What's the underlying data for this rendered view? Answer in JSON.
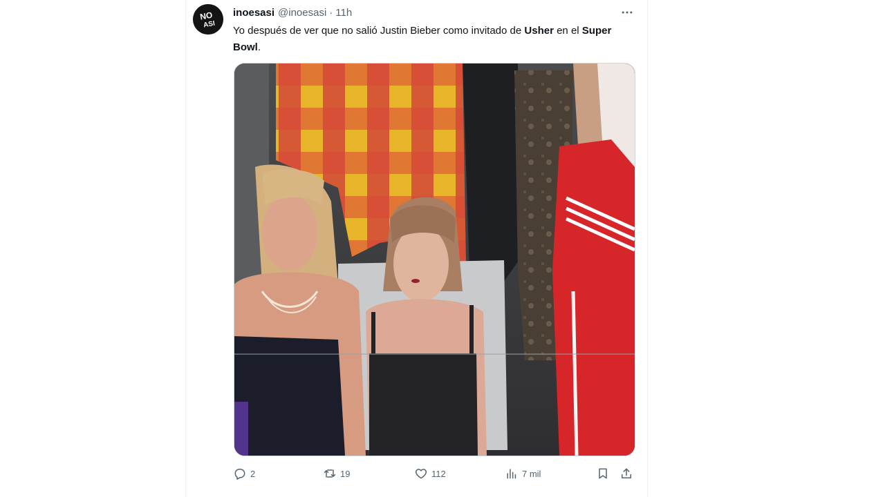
{
  "tweet": {
    "author_name": "inoesasi",
    "handle": "@inoesasi",
    "separator": "·",
    "time": "11h",
    "avatar_text": "NO ASI",
    "text_part1": "Yo después de ver que no salió Justin Bieber como invitado de ",
    "text_bold1": "Usher",
    "text_part2": " en el ",
    "text_bold2": "Super Bowl",
    "text_part3": "."
  },
  "actions": {
    "replies": "2",
    "retweets": "19",
    "likes": "112",
    "views": "7 mil"
  },
  "colors": {
    "text_primary": "#0f1419",
    "text_secondary": "#536471",
    "border": "#eff3f4"
  },
  "icons": [
    "more-icon",
    "reply-icon",
    "retweet-icon",
    "like-icon",
    "views-icon",
    "bookmark-icon",
    "share-icon"
  ]
}
